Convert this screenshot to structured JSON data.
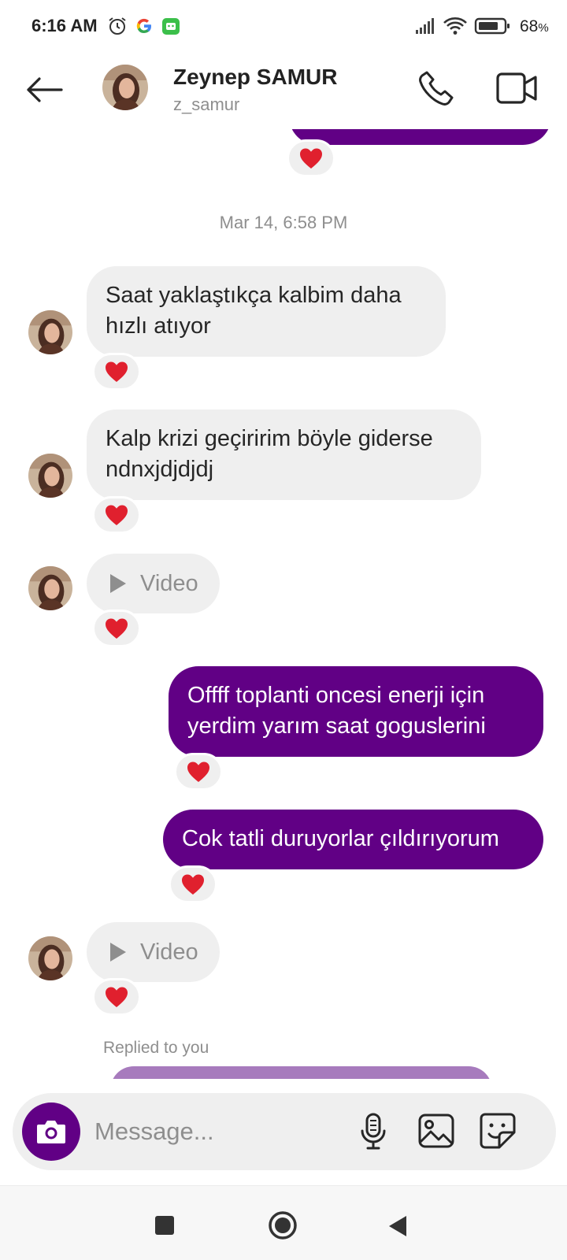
{
  "status_bar": {
    "time": "6:16 AM",
    "battery": "68",
    "icons": [
      "alarm-icon",
      "google-icon",
      "app-notification-icon",
      "signal-icon",
      "wifi-icon",
      "battery-icon"
    ]
  },
  "header": {
    "name": "Zeynep SAMUR",
    "username": "z_samur",
    "icons": [
      "back-arrow-icon",
      "phone-icon",
      "video-camera-icon"
    ]
  },
  "thread": {
    "timestamp": "Mar 14, 6:58 PM",
    "messages": [
      {
        "from": "them",
        "type": "text",
        "text": "Saat yaklaştıkça kalbim daha hızlı atıyor",
        "reaction": "❤️"
      },
      {
        "from": "them",
        "type": "text",
        "text": "Kalp krizi geçiririm böyle giderse ndnxjdjdjdj",
        "reaction": "❤️"
      },
      {
        "from": "them",
        "type": "video",
        "text": "Video",
        "reaction": "❤️"
      },
      {
        "from": "me",
        "type": "text",
        "text": "Offff toplanti oncesi enerji için yerdim yarım saat goguslerini",
        "reaction": "❤️"
      },
      {
        "from": "me",
        "type": "text",
        "text": "Cok tatli duruyorlar çıldırıyorum",
        "reaction": "❤️"
      },
      {
        "from": "them",
        "type": "video",
        "text": "Video",
        "reaction": "❤️"
      }
    ],
    "replied_label": "Replied to you"
  },
  "composer": {
    "placeholder": "Message...",
    "icons": [
      "camera-icon",
      "microphone-icon",
      "gallery-icon",
      "sticker-icon"
    ]
  },
  "colors": {
    "outgoing_bubble": "#610085",
    "incoming_bubble": "#efefef",
    "reaction_heart": "#e0202e"
  }
}
